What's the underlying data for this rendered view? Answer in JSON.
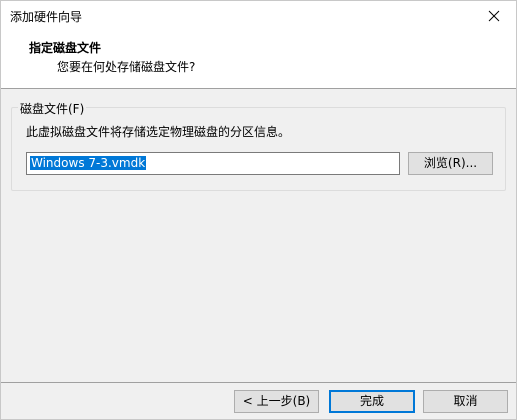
{
  "window": {
    "title": "添加硬件向导"
  },
  "header": {
    "title": "指定磁盘文件",
    "subtitle": "您要在何处存储磁盘文件?"
  },
  "disk_file_group": {
    "label": "磁盘文件(F)",
    "description": "此虚拟磁盘文件将存储选定物理磁盘的分区信息。",
    "path_value": "Windows 7-3.vmdk",
    "browse_label": "浏览(R)..."
  },
  "footer": {
    "prev_label": "< 上一步(B)",
    "finish_label": "完成",
    "cancel_label": "取消"
  }
}
